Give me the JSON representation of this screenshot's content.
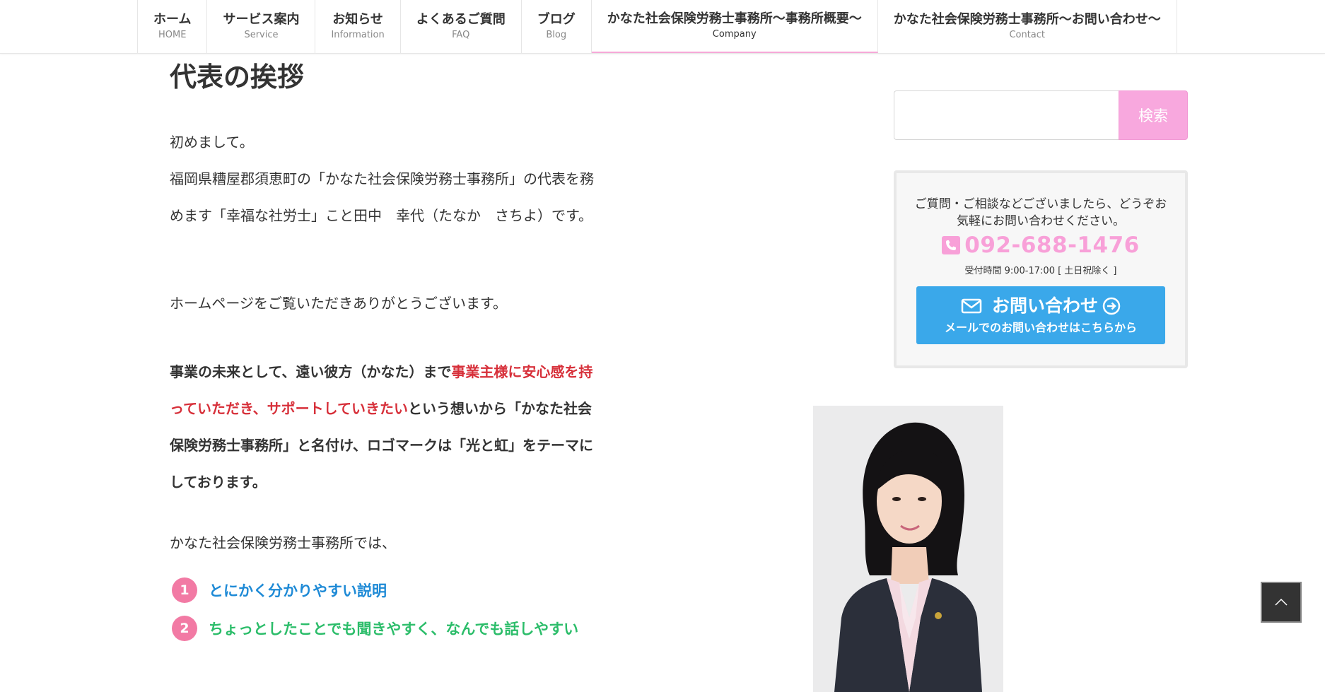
{
  "nav": {
    "items": [
      {
        "ja": "ホーム",
        "en": "HOME"
      },
      {
        "ja": "サービス案内",
        "en": "Service"
      },
      {
        "ja": "お知らせ",
        "en": "Information"
      },
      {
        "ja": "よくあるご質問",
        "en": "FAQ"
      },
      {
        "ja": "ブログ",
        "en": "Blog"
      },
      {
        "ja": "かなた社会保険労務士事務所～事務所概要～",
        "en": "Company"
      },
      {
        "ja": "かなた社会保険労務士事務所～お問い合わせ～",
        "en": "Contact"
      }
    ],
    "active_index": 5
  },
  "main": {
    "title": "代表の挨拶",
    "p1": "初めまして。\n福岡県糟屋郡須恵町の「かなた社会保険労務士事務所」の代表を務めます「幸福な社労士」こと田中　幸代（たなか　さちよ）です。",
    "p2": "ホームページをご覧いただきありがとうございます。",
    "p3": {
      "before": "事業の未来として、遠い彼方（かなた）まで",
      "highlight": "事業主様に安心感を持っていただき、サポートしていきたい",
      "after": "という想いから「かなた社会保険労務士事務所」と名付け、ロゴマークは「光と虹」をテーマにしております。"
    },
    "p4": "かなた社会保険労務士事務所では、",
    "list": [
      {
        "num": "1",
        "text": "とにかく分かりやすい説明"
      },
      {
        "num": "2",
        "text": "ちょっとしたことでも聞きやすく、なんでも話しやすい"
      }
    ]
  },
  "sidebar": {
    "search": {
      "button": "検索",
      "placeholder": ""
    },
    "contact": {
      "text": "ご質問・ご相談などございましたら、どうぞお気軽にお問い合わせください。",
      "phone": "092-688-1476",
      "hours": "受付時間 9:00-17:00 [ 土日祝除く ]",
      "button_main": "お問い合わせ",
      "button_sub": "メールでのお問い合わせはこちらから"
    }
  },
  "colors": {
    "accent_pink": "#f8a0d8",
    "button_blue": "#3aa8ea",
    "highlight_red": "#d7303a",
    "list_blue": "#1e8ad6",
    "list_green": "#2cbd6a",
    "num_pink": "#f27aa4"
  }
}
